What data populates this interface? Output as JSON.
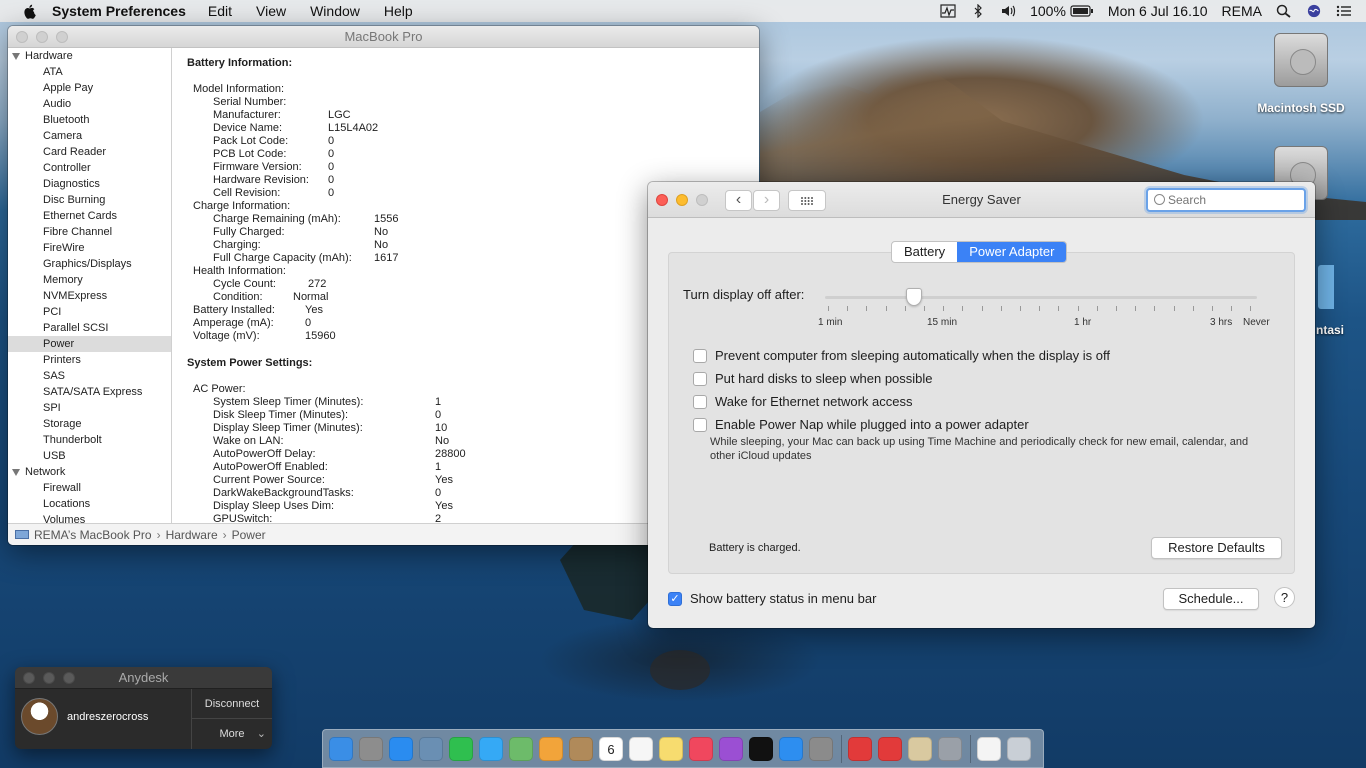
{
  "menubar": {
    "app_name": "System Preferences",
    "menus": [
      "Edit",
      "View",
      "Window",
      "Help"
    ],
    "battery_percent": "100%",
    "datetime": "Mon 6 Jul  16.10",
    "user": "REMA"
  },
  "desktop": {
    "icons": [
      {
        "label": "Macintosh SSD"
      },
      {
        "label": ""
      },
      {
        "label": "ntasi"
      }
    ]
  },
  "sysinfo": {
    "title": "MacBook Pro",
    "sidebar": [
      {
        "label": "Hardware",
        "type": "group"
      },
      {
        "label": "ATA",
        "type": "child"
      },
      {
        "label": "Apple Pay",
        "type": "child"
      },
      {
        "label": "Audio",
        "type": "child"
      },
      {
        "label": "Bluetooth",
        "type": "child"
      },
      {
        "label": "Camera",
        "type": "child"
      },
      {
        "label": "Card Reader",
        "type": "child"
      },
      {
        "label": "Controller",
        "type": "child"
      },
      {
        "label": "Diagnostics",
        "type": "child"
      },
      {
        "label": "Disc Burning",
        "type": "child"
      },
      {
        "label": "Ethernet Cards",
        "type": "child"
      },
      {
        "label": "Fibre Channel",
        "type": "child"
      },
      {
        "label": "FireWire",
        "type": "child"
      },
      {
        "label": "Graphics/Displays",
        "type": "child"
      },
      {
        "label": "Memory",
        "type": "child"
      },
      {
        "label": "NVMExpress",
        "type": "child"
      },
      {
        "label": "PCI",
        "type": "child"
      },
      {
        "label": "Parallel SCSI",
        "type": "child"
      },
      {
        "label": "Power",
        "type": "child",
        "selected": true
      },
      {
        "label": "Printers",
        "type": "child"
      },
      {
        "label": "SAS",
        "type": "child"
      },
      {
        "label": "SATA/SATA Express",
        "type": "child"
      },
      {
        "label": "SPI",
        "type": "child"
      },
      {
        "label": "Storage",
        "type": "child"
      },
      {
        "label": "Thunderbolt",
        "type": "child"
      },
      {
        "label": "USB",
        "type": "child"
      },
      {
        "label": "Network",
        "type": "group"
      },
      {
        "label": "Firewall",
        "type": "child"
      },
      {
        "label": "Locations",
        "type": "child"
      },
      {
        "label": "Volumes",
        "type": "child"
      }
    ],
    "battery_title": "Battery Information:",
    "battery_rows": [
      {
        "k": "Model Information:",
        "v": "",
        "lvl": 0,
        "col": 0
      },
      {
        "k": "Serial Number:",
        "v": "",
        "lvl": 1,
        "col": 0
      },
      {
        "k": "Manufacturer:",
        "v": "LGC",
        "lvl": 1,
        "col": 1
      },
      {
        "k": "Device Name:",
        "v": "L15L4A02",
        "lvl": 1,
        "col": 1
      },
      {
        "k": "Pack Lot Code:",
        "v": "0",
        "lvl": 1,
        "col": 1
      },
      {
        "k": "PCB Lot Code:",
        "v": "0",
        "lvl": 1,
        "col": 1
      },
      {
        "k": "Firmware Version:",
        "v": "0",
        "lvl": 1,
        "col": 1
      },
      {
        "k": "Hardware Revision:",
        "v": "0",
        "lvl": 1,
        "col": 1
      },
      {
        "k": "Cell Revision:",
        "v": "0",
        "lvl": 1,
        "col": 1
      },
      {
        "k": "Charge Information:",
        "v": "",
        "lvl": 0,
        "col": 0
      },
      {
        "k": "Charge Remaining (mAh):",
        "v": "1556",
        "lvl": 1,
        "col": 2
      },
      {
        "k": "Fully Charged:",
        "v": "No",
        "lvl": 1,
        "col": 2
      },
      {
        "k": "Charging:",
        "v": "No",
        "lvl": 1,
        "col": 2
      },
      {
        "k": "Full Charge Capacity (mAh):",
        "v": "1617",
        "lvl": 1,
        "col": 2
      },
      {
        "k": "Health Information:",
        "v": "",
        "lvl": 0,
        "col": 0
      },
      {
        "k": "Cycle Count:",
        "v": "272",
        "lvl": 1,
        "col": 3
      },
      {
        "k": "Condition:",
        "v": "Normal",
        "lvl": 1,
        "col": 4
      },
      {
        "k": "Battery Installed:",
        "v": "Yes",
        "lvl": 0,
        "col": 5
      },
      {
        "k": "Amperage (mA):",
        "v": "0",
        "lvl": 0,
        "col": 5
      },
      {
        "k": "Voltage (mV):",
        "v": "15960",
        "lvl": 0,
        "col": 5
      }
    ],
    "power_title": "System Power Settings:",
    "power_rows": [
      {
        "k": "AC Power:",
        "v": "",
        "lvl": 0
      },
      {
        "k": "System Sleep Timer (Minutes):",
        "v": "1",
        "lvl": 1
      },
      {
        "k": "Disk Sleep Timer (Minutes):",
        "v": "0",
        "lvl": 1
      },
      {
        "k": "Display Sleep Timer (Minutes):",
        "v": "10",
        "lvl": 1
      },
      {
        "k": "Wake on LAN:",
        "v": "No",
        "lvl": 1
      },
      {
        "k": "AutoPowerOff Delay:",
        "v": "28800",
        "lvl": 1
      },
      {
        "k": "AutoPowerOff Enabled:",
        "v": "1",
        "lvl": 1
      },
      {
        "k": "Current Power Source:",
        "v": "Yes",
        "lvl": 1
      },
      {
        "k": "DarkWakeBackgroundTasks:",
        "v": "0",
        "lvl": 1
      },
      {
        "k": "Display Sleep Uses Dim:",
        "v": "Yes",
        "lvl": 1
      },
      {
        "k": "GPUSwitch:",
        "v": "2",
        "lvl": 1
      }
    ],
    "breadcrumb": [
      "REMA’s MacBook Pro",
      "Hardware",
      "Power"
    ]
  },
  "energy": {
    "title": "Energy Saver",
    "search_placeholder": "Search",
    "tabs": [
      {
        "label": "Battery",
        "active": false
      },
      {
        "label": "Power Adapter",
        "active": true
      }
    ],
    "slider_label": "Turn display off after:",
    "slider_ticks": [
      "1 min",
      "15 min",
      "1 hr",
      "3 hrs",
      "Never"
    ],
    "slider_value": "10 min",
    "options": [
      {
        "label": "Prevent computer from sleeping automatically when the display is off",
        "checked": false
      },
      {
        "label": "Put hard disks to sleep when possible",
        "checked": false
      },
      {
        "label": "Wake for Ethernet network access",
        "checked": false
      },
      {
        "label": "Enable Power Nap while plugged into a power adapter",
        "checked": false
      }
    ],
    "power_nap_desc": "While sleeping, your Mac can back up using Time Machine and periodically check for new email, calendar, and other iCloud updates",
    "battery_status": "Battery is charged.",
    "restore_label": "Restore Defaults",
    "show_status_label": "Show battery status in menu bar",
    "show_status_checked": true,
    "schedule_label": "Schedule...",
    "help_label": "?"
  },
  "anydesk": {
    "title": "Anydesk",
    "user": "andreszerocross",
    "disconnect_label": "Disconnect",
    "more_label": "More"
  },
  "dock": {
    "apps": [
      {
        "name": "finder-icon",
        "color": "#3a8ee6"
      },
      {
        "name": "launchpad-icon",
        "color": "#8d8d8d"
      },
      {
        "name": "safari-icon",
        "color": "#2a8cf0"
      },
      {
        "name": "preview-icon",
        "color": "#6a8fb3"
      },
      {
        "name": "facetime-icon",
        "color": "#2fbf4f"
      },
      {
        "name": "messages-icon",
        "color": "#35a9f5"
      },
      {
        "name": "maps-icon",
        "color": "#6dbb6a"
      },
      {
        "name": "photos-icon",
        "color": "#f2a43a"
      },
      {
        "name": "contacts-icon",
        "color": "#b08a5a"
      },
      {
        "name": "calendar-icon",
        "color": "#ffffff"
      },
      {
        "name": "reminders-icon",
        "color": "#f6f6f6"
      },
      {
        "name": "notes-icon",
        "color": "#f7dc6f"
      },
      {
        "name": "music-icon",
        "color": "#f0475e"
      },
      {
        "name": "podcasts-icon",
        "color": "#9b4fd3"
      },
      {
        "name": "tv-icon",
        "color": "#111111"
      },
      {
        "name": "app-store-icon",
        "color": "#2d8ef0"
      },
      {
        "name": "system-preferences-icon",
        "color": "#8b8b8b"
      },
      {
        "name": "anydesk-icon",
        "color": "#e23a3a"
      },
      {
        "name": "anydesk-2-icon",
        "color": "#e23a3a"
      },
      {
        "name": "script-editor-icon",
        "color": "#d9c9a0"
      },
      {
        "name": "disk-utility-icon",
        "color": "#9aa0a8"
      },
      {
        "name": "document-icon",
        "color": "#f4f4f4"
      },
      {
        "name": "trash-icon",
        "color": "#c9cfd6"
      }
    ],
    "calendar_day": "6"
  }
}
